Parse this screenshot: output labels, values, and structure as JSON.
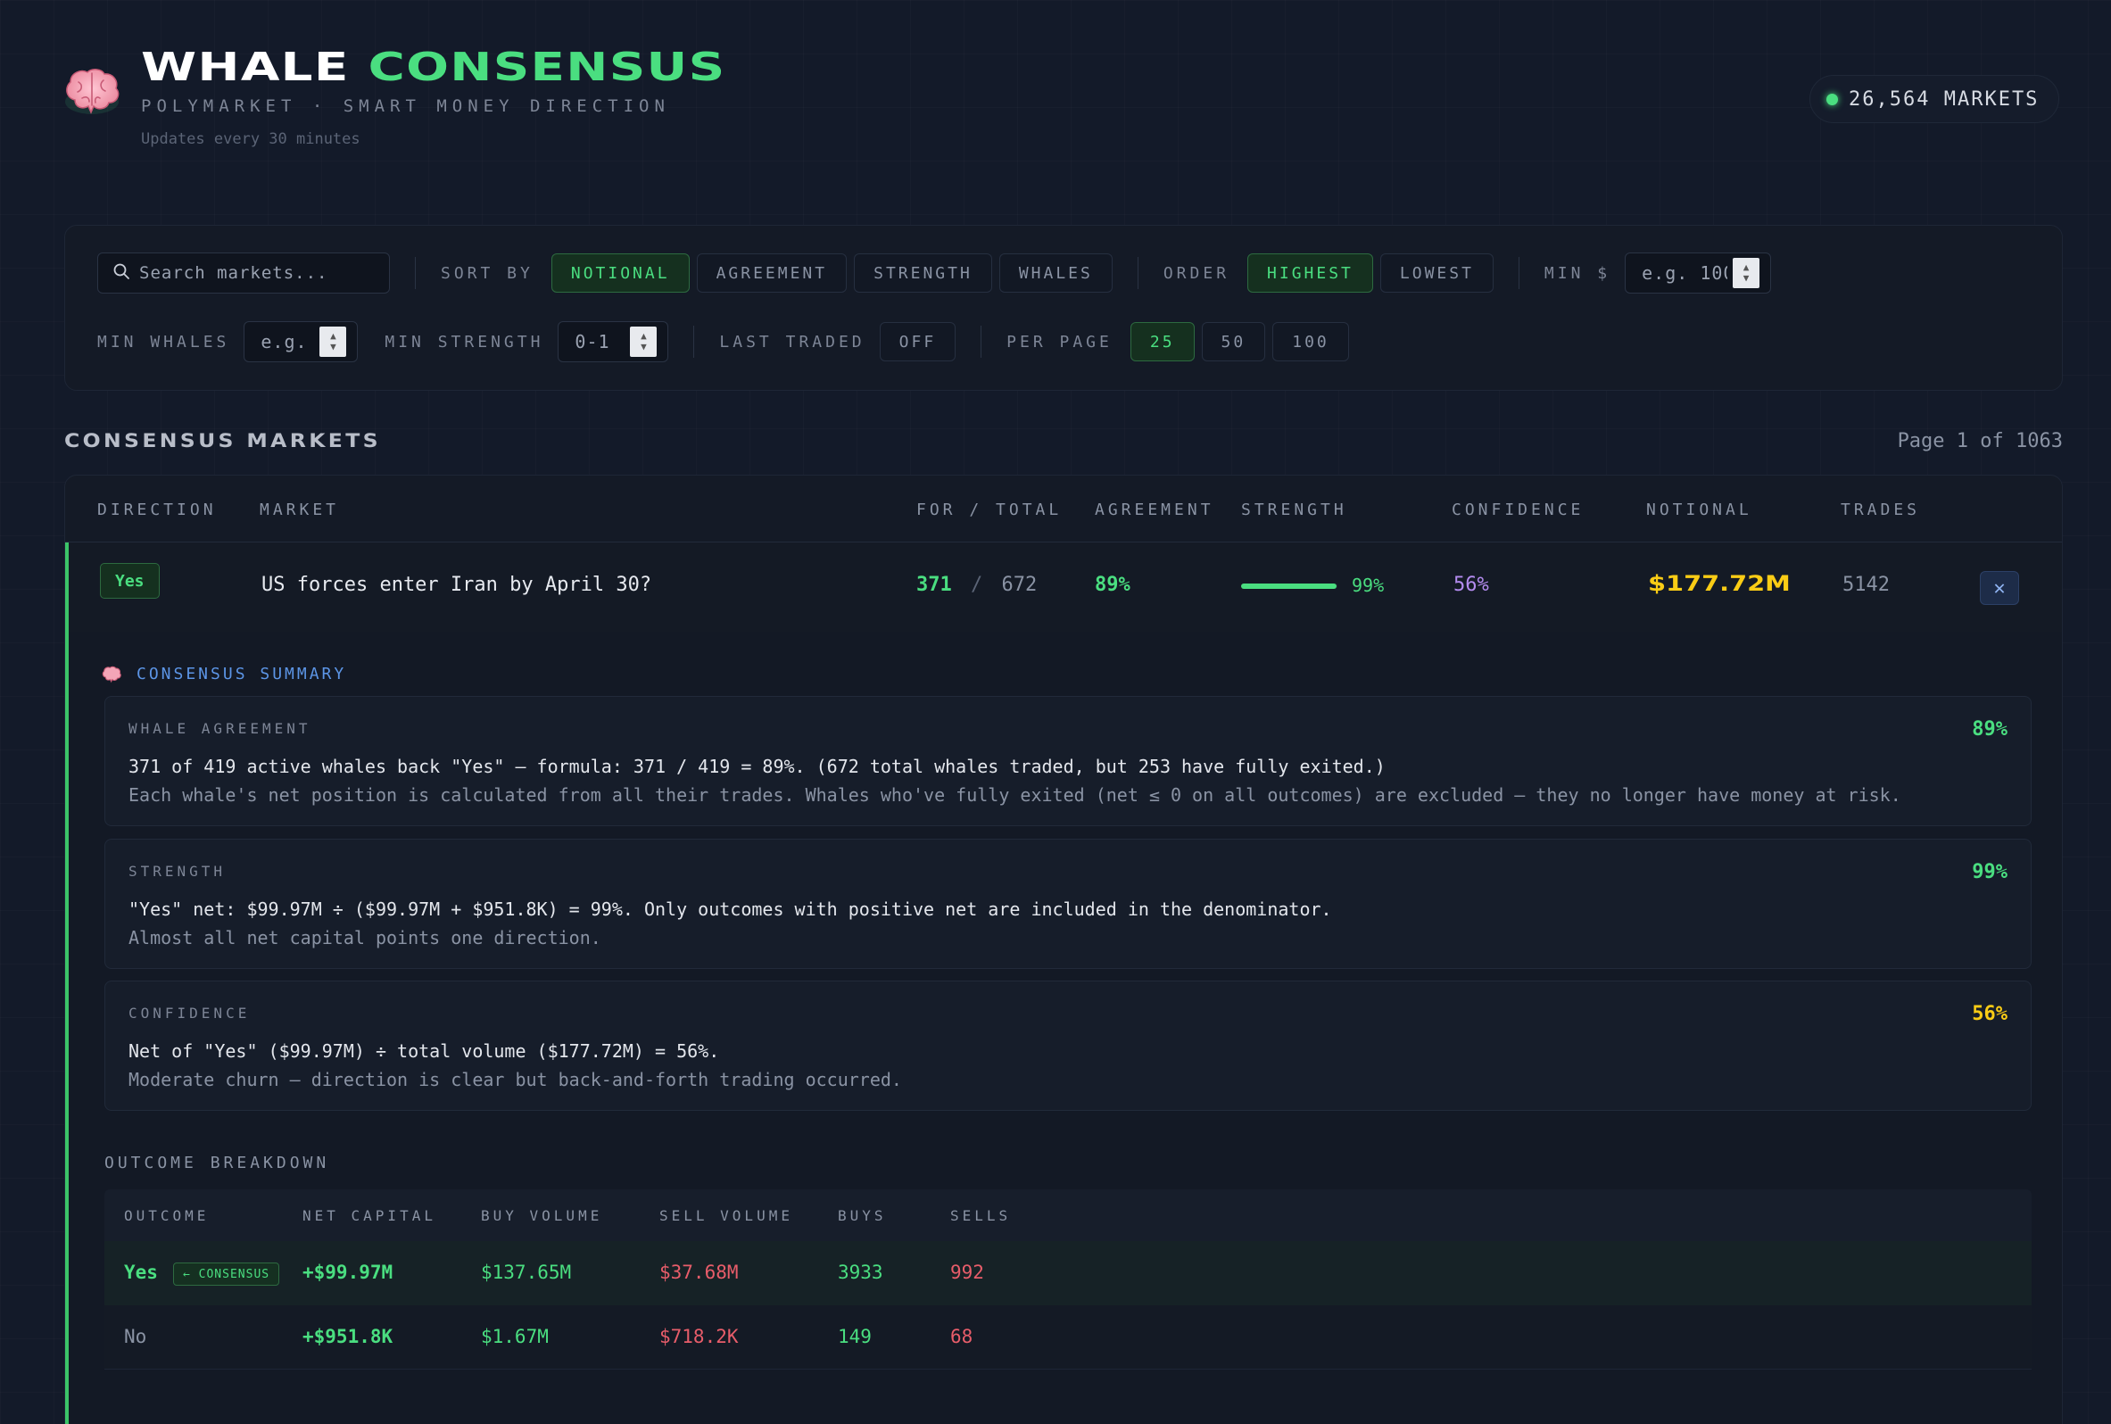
{
  "header": {
    "title_white": "WHALE",
    "title_green": "CONSENSUS",
    "subtitle": "POLYMARKET · SMART MONEY DIRECTION",
    "updates": "Updates every 30 minutes",
    "markets_count": "26,564 MARKETS",
    "logo_icon": "brain-icon"
  },
  "filters": {
    "search_placeholder": "Search markets...",
    "sort_label": "SORT BY",
    "sort_options": [
      "NOTIONAL",
      "AGREEMENT",
      "STRENGTH",
      "WHALES"
    ],
    "sort_selected": "NOTIONAL",
    "order_label": "ORDER",
    "order_options": [
      "HIGHEST",
      "LOWEST"
    ],
    "order_selected": "HIGHEST",
    "min_usd_label": "MIN $",
    "min_usd_placeholder": "e.g. 100",
    "min_whales_label": "MIN WHALES",
    "min_whales_placeholder": "e.g.",
    "min_strength_label": "MIN STRENGTH",
    "min_strength_placeholder": "0-1",
    "last_traded_label": "LAST TRADED",
    "last_traded_value": "OFF",
    "per_page_label": "PER PAGE",
    "per_page_options": [
      "25",
      "50",
      "100"
    ],
    "per_page_selected": "25"
  },
  "section": {
    "title": "CONSENSUS MARKETS",
    "page_info": "Page 1 of 1063"
  },
  "table": {
    "columns": [
      "DIRECTION",
      "MARKET",
      "FOR / TOTAL",
      "AGREEMENT",
      "STRENGTH",
      "CONFIDENCE",
      "NOTIONAL",
      "TRADES"
    ],
    "row": {
      "direction": "Yes",
      "market": "US forces enter Iran by April 30?",
      "for_count": "371",
      "for_sep": "/",
      "total_count": "672",
      "agreement": "89%",
      "strength": "99%",
      "strength_fraction": 0.99,
      "confidence": "56%",
      "notional": "$177.72M",
      "trades": "5142",
      "close_symbol": "✕"
    }
  },
  "summary": {
    "title": "CONSENSUS SUMMARY",
    "agreement": {
      "label": "WHALE AGREEMENT",
      "pct": "89%",
      "line1": "371 of 419 active whales back \"Yes\" — formula: 371 / 419 = 89%. (672 total whales traded, but 253 have fully exited.)",
      "line2": "Each whale's net position is calculated from all their trades. Whales who've fully exited (net ≤ 0 on all outcomes) are excluded — they no longer have money at risk."
    },
    "strength": {
      "label": "STRENGTH",
      "pct": "99%",
      "line1": "\"Yes\" net: $99.97M ÷ ($99.97M + $951.8K) = 99%. Only outcomes with positive net are included in the denominator.",
      "line2": "Almost all net capital points one direction."
    },
    "confidence": {
      "label": "CONFIDENCE",
      "pct": "56%",
      "line1": "Net of \"Yes\" ($99.97M) ÷ total volume ($177.72M) = 56%.",
      "line2": "Moderate churn — direction is clear but back-and-forth trading occurred."
    }
  },
  "breakdown": {
    "title": "OUTCOME BREAKDOWN",
    "columns": [
      "OUTCOME",
      "NET CAPITAL",
      "BUY VOLUME",
      "SELL VOLUME",
      "BUYS",
      "SELLS"
    ],
    "consensus_tag": "← CONSENSUS",
    "rows": [
      {
        "outcome": "Yes",
        "net": "+$99.97M",
        "buy": "$137.65M",
        "sell": "$37.68M",
        "buys": "3933",
        "sells": "992"
      },
      {
        "outcome": "No",
        "net": "+$951.8K",
        "buy": "$1.67M",
        "sell": "$718.2K",
        "buys": "149",
        "sells": "68"
      }
    ]
  },
  "colors": {
    "accent_green": "#4ade80",
    "accent_blue": "#5c95e6",
    "notional_yellow": "#facc15",
    "confidence_purple": "#b48cf0",
    "sell_red": "#e85d6a"
  }
}
